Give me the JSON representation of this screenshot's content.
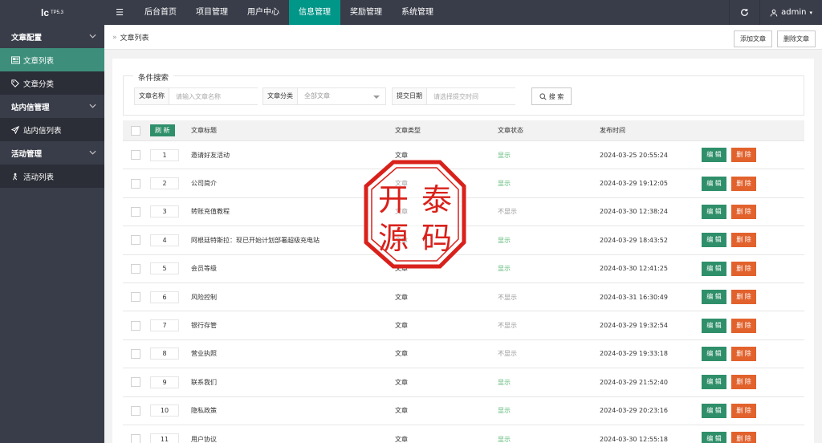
{
  "app": {
    "logo": "lc",
    "logo_sup": "TP5.3",
    "user": "admin"
  },
  "nav": {
    "toggle_glyph": "☰",
    "items": [
      {
        "label": "后台首页"
      },
      {
        "label": "项目管理"
      },
      {
        "label": "用户中心"
      },
      {
        "label": "信息管理",
        "active": true
      },
      {
        "label": "奖励管理"
      },
      {
        "label": "系统管理"
      }
    ]
  },
  "sidebar": {
    "groups": [
      {
        "label": "文章配置",
        "icon": "chevron-down-icon",
        "items": [
          {
            "label": "文章列表",
            "icon": "newspaper-icon",
            "active": true
          },
          {
            "label": "文章分类",
            "icon": "tag-icon"
          }
        ]
      },
      {
        "label": "站内信管理",
        "icon": "chevron-down-icon",
        "items": [
          {
            "label": "站内信列表",
            "icon": "send-icon"
          }
        ]
      },
      {
        "label": "活动管理",
        "icon": "chevron-down-icon",
        "items": [
          {
            "label": "活动列表",
            "icon": "activity-icon"
          }
        ]
      }
    ]
  },
  "breadcrumb": {
    "arrow": "»",
    "current": "文章列表",
    "add_label": "添加文章",
    "delete_label": "删除文章"
  },
  "filter": {
    "legend": "条件搜索",
    "name_label": "文章名称",
    "name_placeholder": "请输入文章名称",
    "category_label": "文章分类",
    "category_value": "全部文章",
    "date_label": "提交日期",
    "date_placeholder": "请选择提交时间",
    "search_label": "搜 索"
  },
  "table": {
    "refresh_label": "刷 新",
    "headers": {
      "title": "文章标题",
      "type": "文章类型",
      "status": "文章状态",
      "time": "发布时间"
    },
    "edit_label": "编 辑",
    "delete_label": "删 除",
    "rows": [
      {
        "id": "1",
        "title": "邀请好友活动",
        "type": "文章",
        "status": "显示",
        "time": "2024-03-25 20:55:24"
      },
      {
        "id": "2",
        "title": "公司简介",
        "type": "文章",
        "status": "显示",
        "time": "2024-03-29 19:12:05"
      },
      {
        "id": "3",
        "title": "转账充值教程",
        "type": "文章",
        "status": "不显示",
        "time": "2024-03-30 12:38:24"
      },
      {
        "id": "4",
        "title": "阿根廷特斯拉：现已开始计划部署超级充电站",
        "type": "文章",
        "status": "显示",
        "time": "2024-03-29 18:43:52"
      },
      {
        "id": "5",
        "title": "会员等级",
        "type": "文章",
        "status": "显示",
        "time": "2024-03-30 12:41:25"
      },
      {
        "id": "6",
        "title": "风险控制",
        "type": "文章",
        "status": "不显示",
        "time": "2024-03-31 16:30:49"
      },
      {
        "id": "7",
        "title": "银行存管",
        "type": "文章",
        "status": "不显示",
        "time": "2024-03-29 19:32:54"
      },
      {
        "id": "8",
        "title": "营业执照",
        "type": "文章",
        "status": "不显示",
        "time": "2024-03-29 19:33:18"
      },
      {
        "id": "9",
        "title": "联系我们",
        "type": "文章",
        "status": "显示",
        "time": "2024-03-29 21:52:40"
      },
      {
        "id": "10",
        "title": "隐私政策",
        "type": "文章",
        "status": "显示",
        "time": "2024-03-29 20:23:16"
      },
      {
        "id": "11",
        "title": "用户协议",
        "type": "文章",
        "status": "显示",
        "time": "2024-03-30 12:55:18"
      }
    ]
  },
  "watermark": {
    "chars": [
      "开",
      "泰",
      "源",
      "码"
    ]
  },
  "colors": {
    "topbar": "#393d49",
    "accent": "#009688",
    "edit": "#2f8f6a",
    "delete": "#e2622d",
    "shown": "#5fb878",
    "seal": "#d9211b"
  }
}
